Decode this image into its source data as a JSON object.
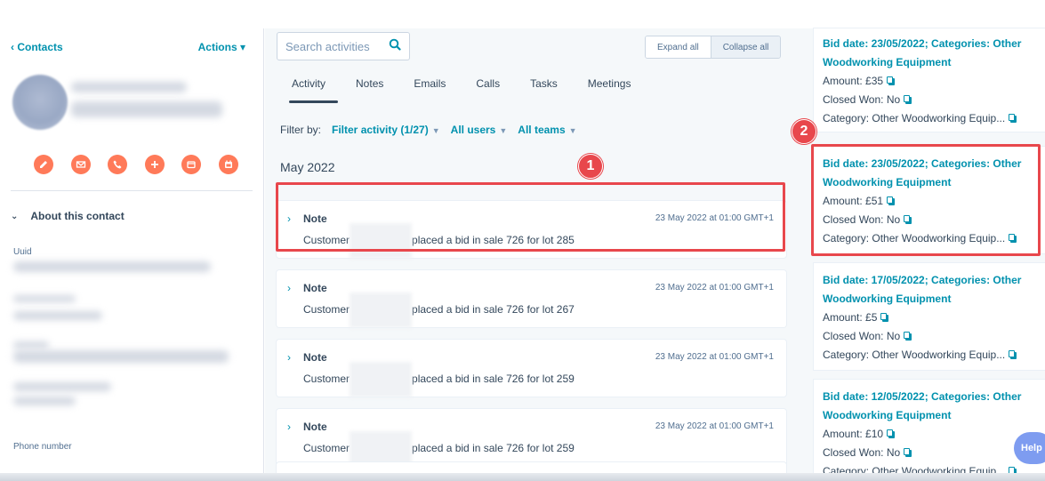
{
  "sidebar": {
    "back_label": "‹  Contacts",
    "actions_label": "Actions ▾",
    "about_label": "About this contact",
    "uuid_label": "Uuid",
    "phone_label": "Phone number",
    "action_icons": [
      "note-icon",
      "email-icon",
      "call-icon",
      "add-icon",
      "meeting-icon",
      "calendar-icon"
    ]
  },
  "timeline": {
    "search_placeholder": "Search activities",
    "expand_all": "Expand all",
    "collapse_all": "Collapse all",
    "tabs": [
      {
        "label": "Activity",
        "active": true
      },
      {
        "label": "Notes"
      },
      {
        "label": "Emails"
      },
      {
        "label": "Calls"
      },
      {
        "label": "Tasks"
      },
      {
        "label": "Meetings"
      }
    ],
    "filter_by": "Filter by:",
    "filter_activity": "Filter activity (1/27)",
    "all_users": "All users",
    "all_teams": "All teams",
    "month": "May 2022",
    "items": [
      {
        "type": "Note",
        "date": "23 May 2022 at 01:00 GMT+1",
        "prefix": "Customer",
        "text": "placed a bid in sale 726 for lot 285"
      },
      {
        "type": "Note",
        "date": "23 May 2022 at 01:00 GMT+1",
        "prefix": "Customer",
        "text": "placed a bid in sale 726 for lot 267"
      },
      {
        "type": "Note",
        "date": "23 May 2022 at 01:00 GMT+1",
        "prefix": "Customer",
        "text": "placed a bid in sale 726 for lot 259"
      },
      {
        "type": "Note",
        "date": "23 May 2022 at 01:00 GMT+1",
        "prefix": "Customer",
        "text": "placed a bid in sale 726 for lot 259"
      }
    ]
  },
  "deals": [
    {
      "title": "Bid date: 23/05/2022; Categories: Other Woodworking Equipment",
      "amount": "Amount:  £35",
      "closed": "Closed Won:  No",
      "category": "Category:  Other Woodworking Equip..."
    },
    {
      "title": "Bid date: 23/05/2022; Categories: Other Woodworking Equipment",
      "amount": "Amount:  £51",
      "closed": "Closed Won:  No",
      "category": "Category:  Other Woodworking Equip..."
    },
    {
      "title": "Bid date: 17/05/2022; Categories: Other Woodworking Equipment",
      "amount": "Amount:  £5",
      "closed": "Closed Won:  No",
      "category": "Category:  Other Woodworking Equip..."
    },
    {
      "title": "Bid date: 12/05/2022; Categories: Other Woodworking Equipment",
      "amount": "Amount:  £10",
      "closed": "Closed Won:  No",
      "category": "Category:  Other Woodworking Equip..."
    }
  ],
  "annotations": {
    "badge_1": "1",
    "badge_2": "2"
  },
  "help_label": "Help",
  "colors": {
    "accent": "#0091ae",
    "action": "#ff7a59",
    "highlight": "#e8474c",
    "text": "#33475b"
  }
}
